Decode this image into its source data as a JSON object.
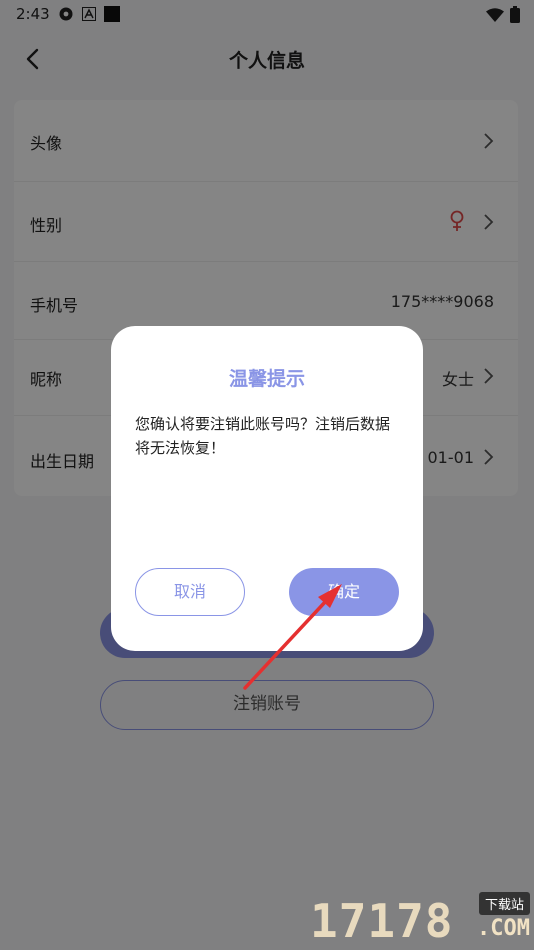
{
  "status": {
    "time": "2:43",
    "icons_left": [
      "settings-gear-icon",
      "font-a-icon",
      "black-square-icon"
    ],
    "icons_right": [
      "wifi-icon",
      "battery-icon"
    ]
  },
  "nav": {
    "title": "个人信息",
    "back_icon": "back-chevron-icon"
  },
  "profile": {
    "rows": [
      {
        "label": "头像",
        "value": ""
      },
      {
        "label": "性别",
        "value": ""
      },
      {
        "label": "手机号",
        "value": "175****9068"
      },
      {
        "label": "昵称",
        "value": "女士"
      },
      {
        "label": "出生日期",
        "value": "01-01"
      }
    ],
    "gender_icon": "female-icon"
  },
  "buttons": {
    "save_label": "",
    "cancel_account_label": "注销账号"
  },
  "dialog": {
    "title": "温馨提示",
    "message": "您确认将要注销此账号吗？注销后数据将无法恢复！",
    "cancel_label": "取消",
    "confirm_label": "确定"
  },
  "watermark": {
    "number": "17178",
    "badge": "下载站",
    "domain": ".COM"
  },
  "colors": {
    "accent": "#8a95e6",
    "annotation_arrow": "#e53030",
    "female_icon": "#e04a4a"
  }
}
